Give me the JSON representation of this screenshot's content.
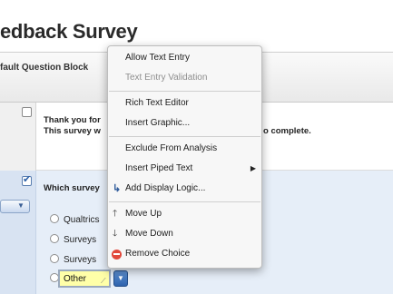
{
  "survey": {
    "title": "edback Survey"
  },
  "block": {
    "label": "fault Question Block"
  },
  "question1": {
    "line1": "Thank you for",
    "line2": "This survey w",
    "tail": "o complete."
  },
  "question2": {
    "text": "Which survey",
    "choices": [
      "Qualtrics",
      "Surveys",
      "Surveys"
    ],
    "other_value": "Other"
  },
  "menu": {
    "items": [
      {
        "label": "Allow Text Entry",
        "enabled": true
      },
      {
        "label": "Text Entry Validation",
        "enabled": false
      },
      {
        "label": "Rich Text Editor",
        "enabled": true
      },
      {
        "label": "Insert Graphic...",
        "enabled": true
      },
      {
        "label": "Exclude From Analysis",
        "enabled": true
      },
      {
        "label": "Insert Piped Text",
        "enabled": true,
        "submenu": true
      },
      {
        "label": "Add Display Logic...",
        "enabled": true,
        "icon": "display-logic-icon"
      },
      {
        "label": "Move Up",
        "enabled": true,
        "icon": "arrow-up-icon"
      },
      {
        "label": "Move Down",
        "enabled": true,
        "icon": "arrow-down-icon"
      },
      {
        "label": "Remove Choice",
        "enabled": true,
        "icon": "remove-icon"
      }
    ]
  },
  "colors": {
    "selected_question_bg": "#e6eef8",
    "other_input_bg": "#ffffa8",
    "remove_icon": "#e1483b",
    "choice_button": "#2d62ad"
  }
}
